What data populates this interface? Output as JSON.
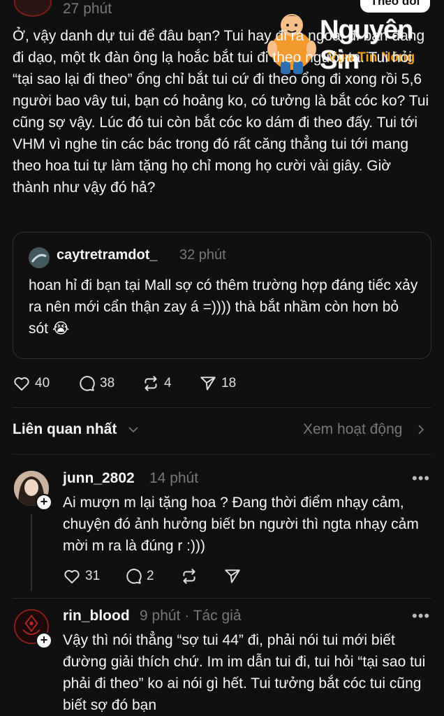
{
  "header": {
    "time": "27 phút",
    "follow_label": "Theo dõi"
  },
  "watermark": {
    "title": "Nguyên Sin",
    "subtitle": "Vựa Tin Nóng"
  },
  "post": {
    "text": "Ở, vậy danh dự tui để đâu bạn? Tui hay đi ra ngoài đi bạn đang đi dạo, một tk đàn ông lạ hoắc bắt tui đi theo người ta. Tui hỏi “tại sao lại đi theo” ổng chỉ bắt tui cứ đi theo ổng đi xong rồi 5,6 người bao vây tui, bạn có hoảng ko, có tưởng là bắt cóc ko? Tui cũng sợ vậy. Lúc đó tui còn bắt cóc ko dám đi theo đấy. Tui tới VHM vì nghe tin các bác trong đó rất căng thẳng tui tới mang theo hoa tui tự làm tặng họ chỉ mong họ cười vài giây. Giờ thành như vậy đó hả?",
    "quote": {
      "username": "caytretramdot_",
      "time": "32 phút",
      "text": "hoan hỉ đi bạn tại Mall sợ có thêm trường hợp đáng tiếc xảy ra nên mới cẩn thận zay á =)))) thà bắt nhầm còn hơn bỏ sót 😭"
    },
    "actions": {
      "likes": "40",
      "comments": "38",
      "reposts": "4",
      "shares": "18"
    }
  },
  "sort": {
    "label": "Liên quan nhất",
    "activity_label": "Xem hoạt động"
  },
  "replies": [
    {
      "username": "junn_2802",
      "time": "14 phút",
      "text": "Ai mượn m lại tặng hoa ? Đang thời điểm nhạy cảm, chuyện đó ảnh hưởng biết bn người thì ngta nhạy cảm mời m ra là đúng r :)))",
      "likes": "31",
      "comments": "2"
    },
    {
      "username": "rin_blood",
      "time": "9 phút · Tác giả",
      "text": "Vậy thì nói thẳng “sợ tui 44” đi, phải nói tui mới biết đường giải thích chứ. Im im dẫn tui đi, tui hỏi “tại sao tui phải đi theo” ko ai nói gì hết. Tui tưởng bắt cóc tui cũng biết sợ đó bạn"
    }
  ],
  "more_label": "•••",
  "colors": {
    "background": "#101010",
    "text": "#f3f5f7",
    "muted": "#777777",
    "accent": "#f0a01c"
  }
}
